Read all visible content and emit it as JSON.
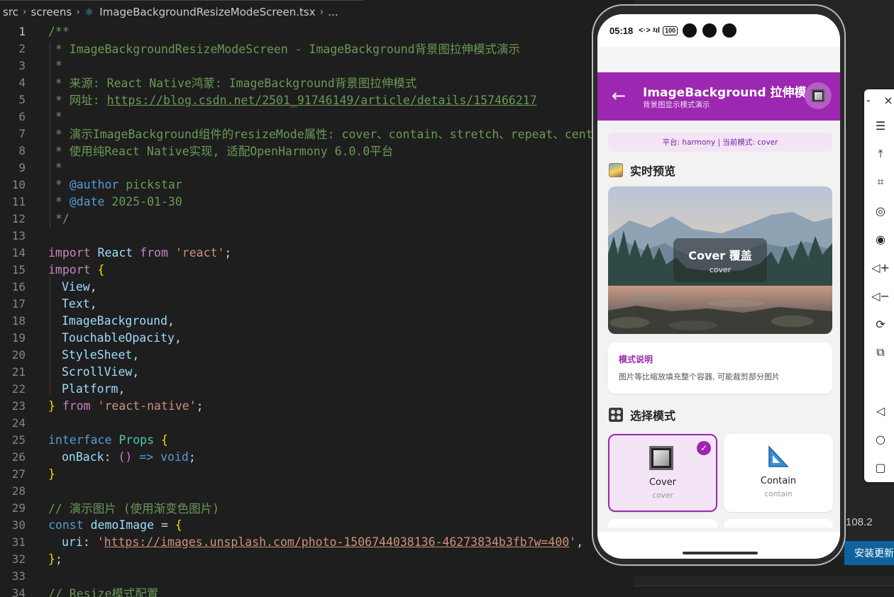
{
  "editor": {
    "breadcrumb": {
      "seg1": "src",
      "seg2": "screens",
      "file": "ImageBackgroundResizeModeScreen.tsx",
      "tail": "..."
    },
    "line_numbers": [
      "1",
      "2",
      "3",
      "4",
      "5",
      "6",
      "7",
      "8",
      "9",
      "10",
      "11",
      "12",
      "13",
      "14",
      "15",
      "16",
      "17",
      "18",
      "19",
      "20",
      "21",
      "22",
      "23",
      "24",
      "25",
      "26",
      "27",
      "28",
      "29",
      "30",
      "31",
      "32",
      "33",
      "34"
    ],
    "lines": {
      "l1": "/**",
      "l2": " * ImageBackgroundResizeModeScreen - ImageBackground背景图拉伸模式演示",
      "l3": " *",
      "l4": " * 来源: React Native鸿蒙: ImageBackground背景图拉伸模式",
      "l5_a": " * 网址: ",
      "l5_b": "https://blog.csdn.net/2501_91746149/article/details/157466217",
      "l6": " *",
      "l7": " * 演示ImageBackground组件的resizeMode属性: cover、contain、stretch、repeat、center",
      "l8": " * 使用纯React Native实现, 适配OpenHarmony 6.0.0平台",
      "l9": " *",
      "l10_a": " * ",
      "l10_b": "@author",
      "l10_c": " pickstar",
      "l11_a": " * ",
      "l11_b": "@date",
      "l11_c": " 2025-01-30",
      "l12": " */",
      "l14_a": "import",
      "l14_b": " React ",
      "l14_c": "from",
      "l14_d": " 'react'",
      "l14_e": ";",
      "l15_a": "import",
      "l15_b": " {",
      "l16": "View",
      "l17": "Text",
      "l18": "ImageBackground",
      "l19": "TouchableOpacity",
      "l20": "StyleSheet",
      "l21": "ScrollView",
      "l22": "Platform",
      "l23_a": "}",
      "l23_b": " from",
      "l23_c": " 'react-native'",
      "l23_d": ";",
      "l25_a": "interface",
      "l25_b": " Props",
      "l25_c": " {",
      "l26_a": "onBack",
      "l26_b": ": ",
      "l26_c": "()",
      "l26_d": " => ",
      "l26_e": "void",
      "l26_f": ";",
      "l27": "}",
      "l29": "// 演示图片 (使用渐变色图片)",
      "l30_a": "const",
      "l30_b": " demoImage",
      "l30_c": " = ",
      "l30_d": "{",
      "l31_a": "uri",
      "l31_b": ": ",
      "l31_c": "'",
      "l31_d": "https://images.unsplash.com/photo-1506744038136-46273834b3fb?w=400",
      "l31_e": "'",
      "l31_f": ",",
      "l32_a": "}",
      "l32_b": ";",
      "l34": "// Resize模式配置"
    },
    "comma": ","
  },
  "side_panel": {
    "version": "108.2",
    "install_label": "安装更新"
  },
  "emulator_toolbar": {
    "minimize": "-",
    "close": "×",
    "icons": [
      "menu-icon",
      "pin-top-icon",
      "crop-icon",
      "location-icon",
      "screen-record-icon",
      "volume-up-icon",
      "volume-down-icon",
      "rotate-icon",
      "screenshot-icon",
      "back-nav-icon",
      "home-nav-icon",
      "recent-apps-icon"
    ]
  },
  "phone": {
    "status": {
      "time": "05:18",
      "signals": "<·> ᵡıl",
      "battery": "100"
    },
    "appbar": {
      "back": "←",
      "title": "ImageBackground 拉伸模式",
      "subtitle": "背景图显示模式演示"
    },
    "platform_info": "平台: harmony | 当前模式: cover",
    "preview_section": "实时预览",
    "preview_overlay": {
      "title": "Cover 覆盖",
      "sub": "cover"
    },
    "description": {
      "title": "模式说明",
      "text": "图片等比缩放填充整个容器, 可能裁剪部分图片"
    },
    "modes_section": "选择模式",
    "modes": [
      {
        "label": "Cover",
        "sub": "cover",
        "selected": true
      },
      {
        "label": "Contain",
        "sub": "contain",
        "selected": false
      }
    ],
    "check": "✓",
    "colors": {
      "primary": "#9c27b0",
      "selected_bg": "#f3e5f5"
    }
  }
}
